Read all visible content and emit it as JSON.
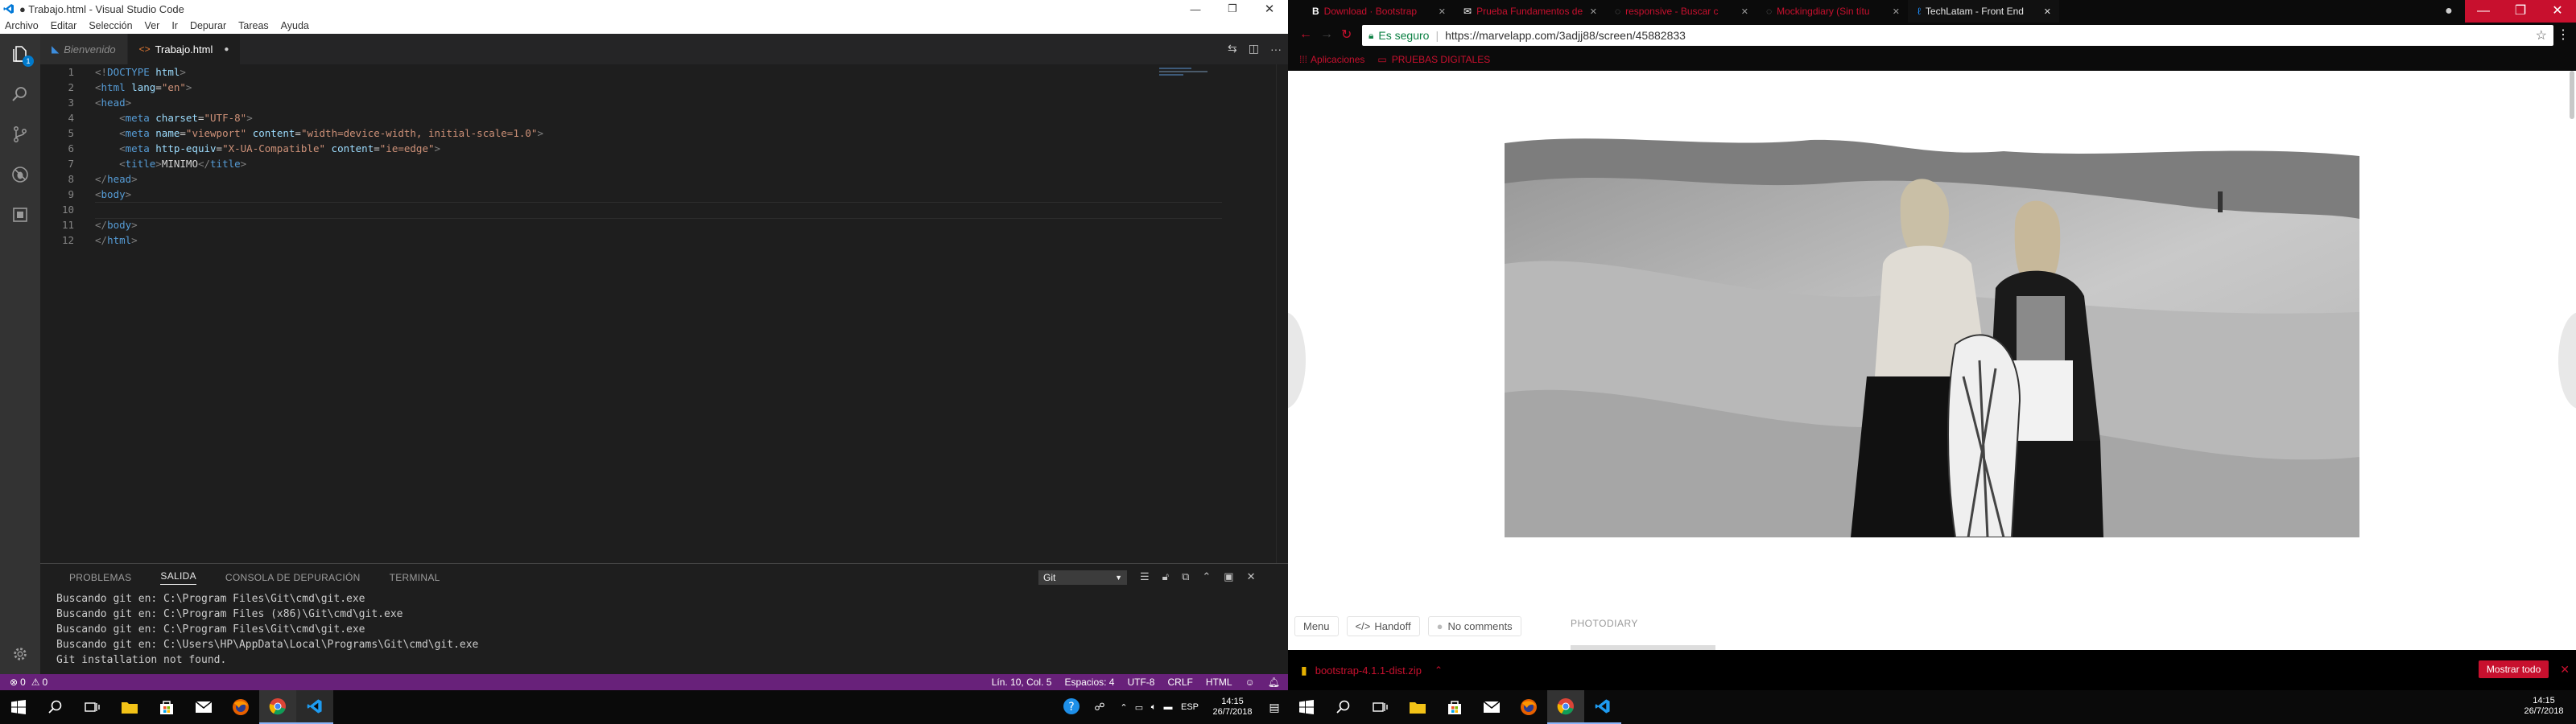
{
  "vscode": {
    "title": "● Trabajo.html - Visual Studio Code",
    "menu": [
      "Archivo",
      "Editar",
      "Selección",
      "Ver",
      "Ir",
      "Depurar",
      "Tareas",
      "Ayuda"
    ],
    "tabs": [
      {
        "label": "Bienvenido"
      },
      {
        "label": "Trabajo.html"
      }
    ],
    "code_lines": [
      {
        "num": "1",
        "parts": [
          {
            "c": "br",
            "t": "<!"
          },
          {
            "c": "tg",
            "t": "DOCTYPE"
          },
          {
            "c": "at",
            "t": " html"
          },
          {
            "c": "br",
            "t": ">"
          }
        ]
      },
      {
        "num": "2",
        "parts": [
          {
            "c": "br",
            "t": "<"
          },
          {
            "c": "tg",
            "t": "html"
          },
          {
            "c": "at",
            "t": " lang"
          },
          {
            "c": "tx",
            "t": "="
          },
          {
            "c": "st",
            "t": "\"en\""
          },
          {
            "c": "br",
            "t": ">"
          }
        ]
      },
      {
        "num": "3",
        "parts": [
          {
            "c": "br",
            "t": "<"
          },
          {
            "c": "tg",
            "t": "head"
          },
          {
            "c": "br",
            "t": ">"
          }
        ]
      },
      {
        "num": "4",
        "parts": [
          {
            "c": "tx",
            "t": "    "
          },
          {
            "c": "br",
            "t": "<"
          },
          {
            "c": "tg",
            "t": "meta"
          },
          {
            "c": "at",
            "t": " charset"
          },
          {
            "c": "tx",
            "t": "="
          },
          {
            "c": "st",
            "t": "\"UTF-8\""
          },
          {
            "c": "br",
            "t": ">"
          }
        ]
      },
      {
        "num": "5",
        "parts": [
          {
            "c": "tx",
            "t": "    "
          },
          {
            "c": "br",
            "t": "<"
          },
          {
            "c": "tg",
            "t": "meta"
          },
          {
            "c": "at",
            "t": " name"
          },
          {
            "c": "tx",
            "t": "="
          },
          {
            "c": "st",
            "t": "\"viewport\""
          },
          {
            "c": "at",
            "t": " content"
          },
          {
            "c": "tx",
            "t": "="
          },
          {
            "c": "st",
            "t": "\"width=device-width, initial-scale=1.0\""
          },
          {
            "c": "br",
            "t": ">"
          }
        ]
      },
      {
        "num": "6",
        "parts": [
          {
            "c": "tx",
            "t": "    "
          },
          {
            "c": "br",
            "t": "<"
          },
          {
            "c": "tg",
            "t": "meta"
          },
          {
            "c": "at",
            "t": " http-equiv"
          },
          {
            "c": "tx",
            "t": "="
          },
          {
            "c": "st",
            "t": "\"X-UA-Compatible\""
          },
          {
            "c": "at",
            "t": " content"
          },
          {
            "c": "tx",
            "t": "="
          },
          {
            "c": "st",
            "t": "\"ie=edge\""
          },
          {
            "c": "br",
            "t": ">"
          }
        ]
      },
      {
        "num": "7",
        "parts": [
          {
            "c": "tx",
            "t": "    "
          },
          {
            "c": "br",
            "t": "<"
          },
          {
            "c": "tg",
            "t": "title"
          },
          {
            "c": "br",
            "t": ">"
          },
          {
            "c": "tx",
            "t": "MINIMO"
          },
          {
            "c": "br",
            "t": "</"
          },
          {
            "c": "tg",
            "t": "title"
          },
          {
            "c": "br",
            "t": ">"
          }
        ]
      },
      {
        "num": "8",
        "parts": [
          {
            "c": "br",
            "t": "</"
          },
          {
            "c": "tg",
            "t": "head"
          },
          {
            "c": "br",
            "t": ">"
          }
        ]
      },
      {
        "num": "9",
        "parts": [
          {
            "c": "br",
            "t": "<"
          },
          {
            "c": "tg",
            "t": "body"
          },
          {
            "c": "br",
            "t": ">"
          }
        ]
      },
      {
        "num": "10",
        "parts": []
      },
      {
        "num": "11",
        "parts": [
          {
            "c": "br",
            "t": "</"
          },
          {
            "c": "tg",
            "t": "body"
          },
          {
            "c": "br",
            "t": ">"
          }
        ]
      },
      {
        "num": "12",
        "parts": [
          {
            "c": "br",
            "t": "</"
          },
          {
            "c": "tg",
            "t": "html"
          },
          {
            "c": "br",
            "t": ">"
          }
        ]
      }
    ],
    "panel_tabs": [
      "PROBLEMAS",
      "SALIDA",
      "CONSOLA DE DEPURACIÓN",
      "TERMINAL"
    ],
    "panel_select": "Git",
    "output_lines": [
      "Buscando git en: C:\\Program Files\\Git\\cmd\\git.exe",
      "Buscando git en: C:\\Program Files (x86)\\Git\\cmd\\git.exe",
      "Buscando git en: C:\\Program Files\\Git\\cmd\\git.exe",
      "Buscando git en: C:\\Users\\HP\\AppData\\Local\\Programs\\Git\\cmd\\git.exe",
      "Git installation not found."
    ],
    "status": {
      "errors": "0",
      "warnings": "0",
      "position": "Lín. 10, Col. 5",
      "spaces": "Espacios: 4",
      "encoding": "UTF-8",
      "eol": "CRLF",
      "language": "HTML"
    },
    "activity_badge": "1"
  },
  "chrome": {
    "tabs": [
      {
        "label": "Download · Bootstrap",
        "active": false
      },
      {
        "label": "Prueba Fundamentos de",
        "active": false
      },
      {
        "label": "responsive - Buscar c",
        "active": false
      },
      {
        "label": "Mockingdiary (Sin títu",
        "active": false
      },
      {
        "label": "TechLatam - Front End",
        "active": true
      }
    ],
    "secure_label": "Es seguro",
    "url": "https://marvelapp.com/3adjj88/screen/45882833",
    "bookmarks": [
      {
        "label": "Aplicaciones"
      },
      {
        "label": "PRUEBAS DIGITALES"
      }
    ],
    "page": {
      "menu": "Menu",
      "handoff": "Handoff",
      "comments": "No comments",
      "label": "PHOTODIARY"
    },
    "download": {
      "file": "bootstrap-4.1.1-dist.zip",
      "show_all": "Mostrar todo"
    }
  },
  "taskbar_left": {
    "lang": "ESP",
    "time": "14:15",
    "date": "26/7/2018"
  },
  "taskbar_right": {
    "time": "14:15",
    "date": "26/7/2018"
  },
  "colors": {
    "vscode_status": "#68217a",
    "chrome_accent": "#c8102e",
    "download_button": "#c8102e"
  }
}
